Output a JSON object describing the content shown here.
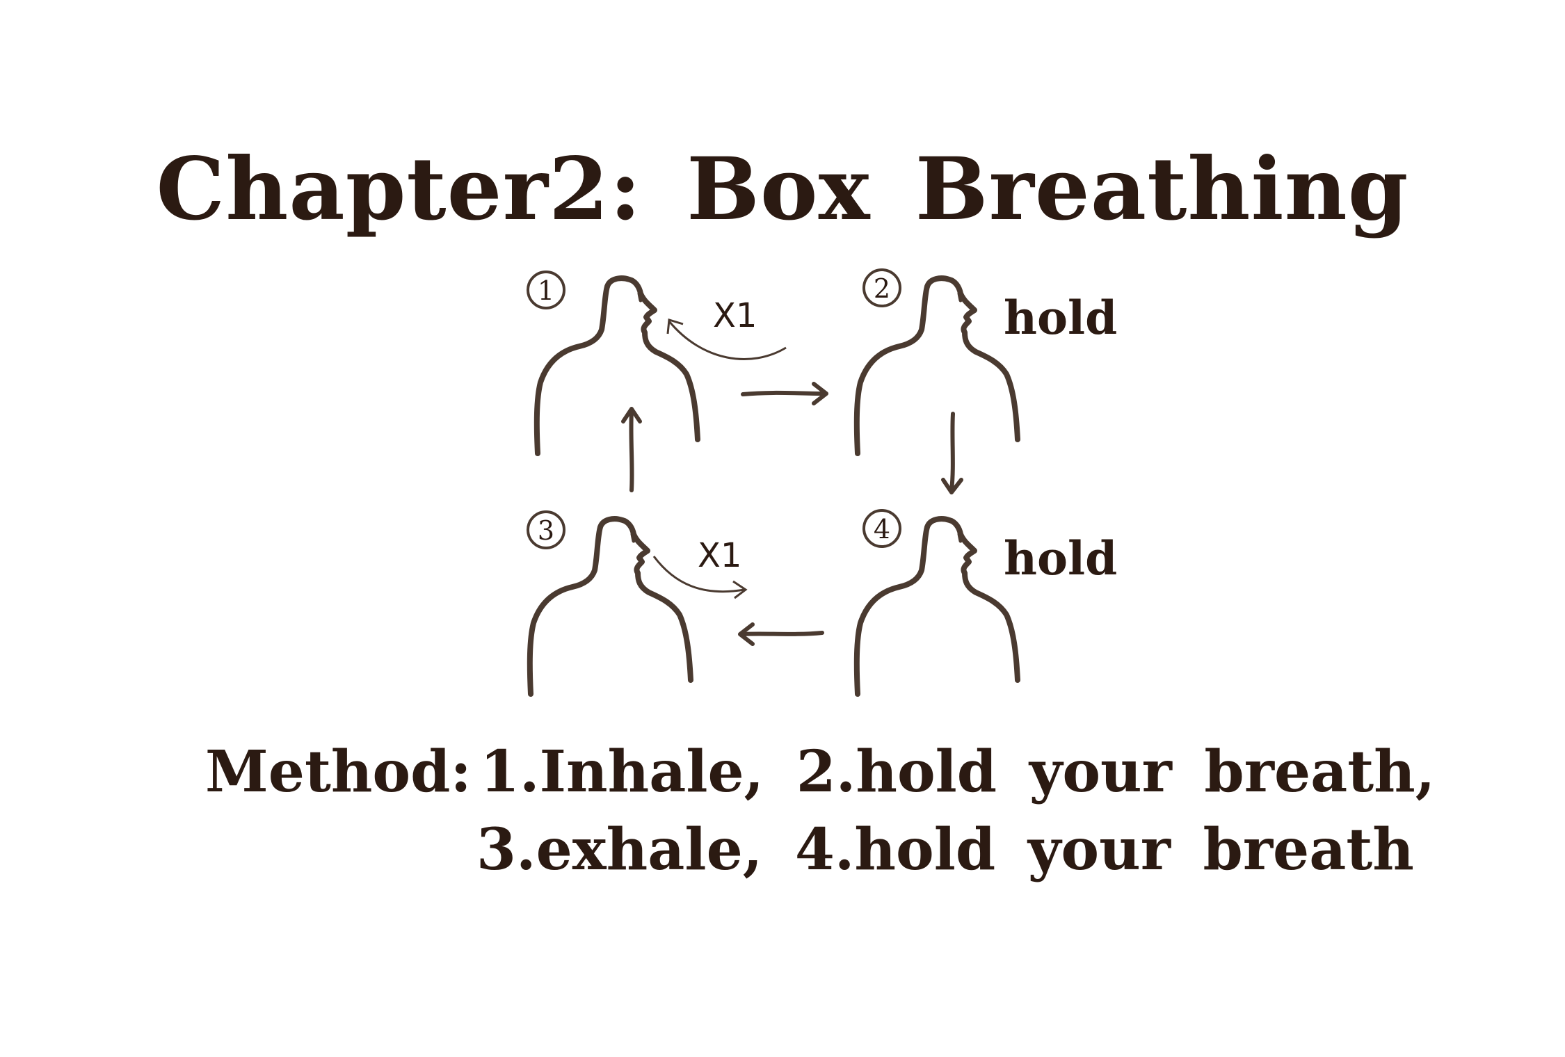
{
  "title": "Chapter2: Box Breathing",
  "steps": [
    {
      "number": "1",
      "label": "X1"
    },
    {
      "number": "2",
      "label": "hold"
    },
    {
      "number": "3",
      "label": "X1"
    },
    {
      "number": "4",
      "label": "hold"
    }
  ],
  "method": {
    "label": "Method:",
    "line1": "1.Inhale, 2.hold your breath,",
    "line2": "3.exhale, 4.hold your breath"
  },
  "colors": {
    "ink": "#2b1a12",
    "sketch": "#4a3a30",
    "background": "#ffffff"
  }
}
